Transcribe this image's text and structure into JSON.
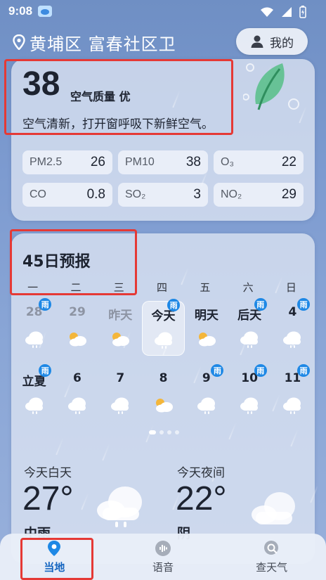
{
  "status_bar": {
    "time": "9:08"
  },
  "header": {
    "location": "黄埔区 富春社区卫",
    "mine_label": "我的"
  },
  "aqi": {
    "value": "38",
    "label": "空气质量 优",
    "description": "空气清新，打开窗呼吸下新鲜空气。",
    "pollutants": [
      {
        "name": "PM2.5",
        "value": "26"
      },
      {
        "name": "PM10",
        "value": "38"
      },
      {
        "name": "O₃",
        "value": "22"
      },
      {
        "name": "CO",
        "value": "0.8"
      },
      {
        "name": "SO₂",
        "value": "3"
      },
      {
        "name": "NO₂",
        "value": "29"
      }
    ]
  },
  "forecast": {
    "title": "45日预报",
    "weekdays": [
      "一",
      "二",
      "三",
      "四",
      "五",
      "六",
      "日"
    ],
    "rain_badge": "雨",
    "row1": [
      {
        "label": "28",
        "dim": true,
        "icon": "rain-cloud-icon",
        "rain": true
      },
      {
        "label": "29",
        "dim": true,
        "icon": "partly-cloudy-icon",
        "rain": false
      },
      {
        "label": "昨天",
        "dim": true,
        "icon": "partly-cloudy-icon",
        "rain": false
      },
      {
        "label": "今天",
        "dim": false,
        "icon": "rain-cloud-icon",
        "rain": true,
        "today": true
      },
      {
        "label": "明天",
        "dim": false,
        "icon": "partly-cloudy-icon",
        "rain": false
      },
      {
        "label": "后天",
        "dim": false,
        "icon": "rain-cloud-icon",
        "rain": true
      },
      {
        "label": "4",
        "dim": false,
        "icon": "rain-cloud-icon",
        "rain": true
      }
    ],
    "row2": [
      {
        "label": "立夏",
        "icon": "rain-cloud-icon",
        "rain": true
      },
      {
        "label": "6",
        "icon": "rain-cloud-icon",
        "rain": false
      },
      {
        "label": "7",
        "icon": "rain-cloud-icon",
        "rain": false
      },
      {
        "label": "8",
        "icon": "partly-cloudy-icon",
        "rain": false
      },
      {
        "label": "9",
        "icon": "rain-cloud-icon",
        "rain": true
      },
      {
        "label": "10",
        "icon": "rain-cloud-icon",
        "rain": true
      },
      {
        "label": "11",
        "icon": "rain-cloud-icon",
        "rain": true
      }
    ]
  },
  "today_detail": {
    "day_label": "今天白天",
    "day_temp": "27°",
    "day_condition": "中雨",
    "night_label": "今天夜间",
    "night_temp": "22°",
    "night_condition": "阴"
  },
  "nav": {
    "items": [
      "当地",
      "语音",
      "查天气"
    ],
    "active": 0
  },
  "colors": {
    "accent": "#1565c0",
    "highlight_box": "#e53935",
    "rain_badge": "#1e88e5",
    "leaf": "#4caf7d"
  }
}
